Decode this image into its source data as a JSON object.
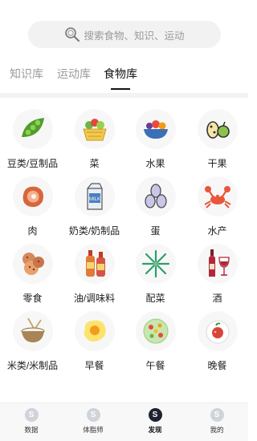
{
  "search": {
    "placeholder": "搜索食物、知识、运动",
    "icon": "search-icon"
  },
  "tabs": [
    {
      "label": "知识库",
      "active": false
    },
    {
      "label": "运动库",
      "active": false
    },
    {
      "label": "食物库",
      "active": true
    }
  ],
  "categories": [
    {
      "label": "豆类/豆制品",
      "icon": "pea-pod-icon"
    },
    {
      "label": "菜",
      "icon": "vegetable-basket-icon"
    },
    {
      "label": "水果",
      "icon": "fruit-bowl-icon"
    },
    {
      "label": "干果",
      "icon": "nuts-icon"
    },
    {
      "label": "肉",
      "icon": "steak-icon"
    },
    {
      "label": "奶类/奶制品",
      "icon": "milk-carton-icon"
    },
    {
      "label": "蛋",
      "icon": "eggs-icon"
    },
    {
      "label": "水产",
      "icon": "crab-icon"
    },
    {
      "label": "零食",
      "icon": "cookies-icon"
    },
    {
      "label": "油/调味料",
      "icon": "condiment-bottles-icon"
    },
    {
      "label": "配菜",
      "icon": "leafy-garnish-icon"
    },
    {
      "label": "酒",
      "icon": "wine-icon"
    },
    {
      "label": "米类/米制品",
      "icon": "rice-bowl-icon"
    },
    {
      "label": "早餐",
      "icon": "fried-egg-icon"
    },
    {
      "label": "午餐",
      "icon": "salad-plate-icon"
    },
    {
      "label": "晚餐",
      "icon": "dinner-plate-icon"
    }
  ],
  "bottom_nav": [
    {
      "label": "数据",
      "badge": "S",
      "active": false
    },
    {
      "label": "体脂师",
      "badge": "S",
      "active": false
    },
    {
      "label": "发现",
      "badge": "S",
      "active": true
    },
    {
      "label": "我的",
      "badge": "S",
      "active": false
    }
  ]
}
